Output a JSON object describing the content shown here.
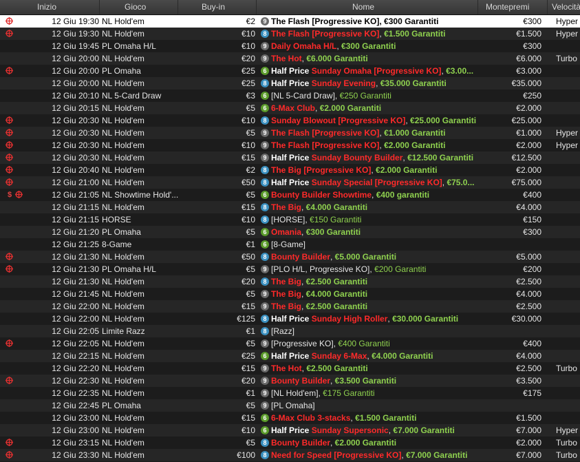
{
  "headers": {
    "start": "Inizio",
    "game": "Gioco",
    "buyin": "Buy-in",
    "name": "Nome",
    "prize": "Montepremi",
    "speed": "Velocità"
  },
  "colors": {
    "red_name": "#ff2a2a",
    "green_guarantee": "#8fd14f",
    "badge6": "#5a9a2a",
    "badge8": "#3a8fbf",
    "badge9": "#6a6a6a"
  },
  "rows": [
    {
      "icon": "target-icon",
      "date": "12 Giu",
      "time": "19:30",
      "game": "NL Hold'em",
      "buyin": "€2",
      "badge": "9",
      "hp": "",
      "red": "",
      "white": "The Flash [Progressive KO], €300 Garantiti",
      "green": "",
      "prize": "€300",
      "speed": "Hyper",
      "selected": true
    },
    {
      "icon": "target-icon",
      "date": "12 Giu",
      "time": "19:30",
      "game": "NL Hold'em",
      "buyin": "€10",
      "badge": "8",
      "hp": "",
      "red": "The Flash [Progressive KO]",
      "white": "",
      "green": "€1.500 Garantiti",
      "prize": "€1.500",
      "speed": "Hyper"
    },
    {
      "icon": "",
      "date": "12 Giu",
      "time": "19:45",
      "game": "PL Omaha H/L",
      "buyin": "€10",
      "badge": "9",
      "hp": "",
      "red": "Daily Omaha H/L",
      "white": "",
      "green": "€300 Garantiti",
      "prize": "€300",
      "speed": ""
    },
    {
      "icon": "",
      "date": "12 Giu",
      "time": "20:00",
      "game": "NL Hold'em",
      "buyin": "€20",
      "badge": "9",
      "hp": "",
      "red": "The Hot",
      "white": "",
      "green": "€6.000 Garantiti",
      "prize": "€6.000",
      "speed": "Turbo"
    },
    {
      "icon": "target-icon",
      "date": "12 Giu",
      "time": "20:00",
      "game": "PL Omaha",
      "buyin": "€25",
      "badge": "6",
      "hp": "Half Price",
      "red": "Sunday Omaha [Progressive KO]",
      "white": "",
      "green": "€3.00...",
      "prize": "€3.000",
      "speed": ""
    },
    {
      "icon": "",
      "date": "12 Giu",
      "time": "20:00",
      "game": "NL Hold'em",
      "buyin": "€25",
      "badge": "8",
      "hp": "Half Price",
      "red": "Sunday Evening",
      "white": "",
      "green": "€35.000 Garantiti",
      "prize": "€35.000",
      "speed": ""
    },
    {
      "icon": "",
      "date": "12 Giu",
      "time": "20:10",
      "game": "NL 5-Card Draw",
      "buyin": "€3",
      "badge": "6",
      "hp": "",
      "red": "",
      "white": "[NL 5-Card Draw]",
      "green": "€250 Garantiti",
      "greenPlain": true,
      "prize": "€250",
      "speed": ""
    },
    {
      "icon": "",
      "date": "12 Giu",
      "time": "20:15",
      "game": "NL Hold'em",
      "buyin": "€5",
      "badge": "6",
      "hp": "",
      "red": "6-Max Club",
      "white": "",
      "green": "€2.000 Garantiti",
      "prize": "€2.000",
      "speed": ""
    },
    {
      "icon": "target-icon",
      "date": "12 Giu",
      "time": "20:30",
      "game": "NL Hold'em",
      "buyin": "€10",
      "badge": "8",
      "hp": "",
      "red": "Sunday Blowout [Progressive KO]",
      "white": "",
      "green": "€25.000 Garantiti",
      "prize": "€25.000",
      "speed": ""
    },
    {
      "icon": "target-icon",
      "date": "12 Giu",
      "time": "20:30",
      "game": "NL Hold'em",
      "buyin": "€5",
      "badge": "9",
      "hp": "",
      "red": "The Flash [Progressive KO]",
      "white": "",
      "green": "€1.000 Garantiti",
      "prize": "€1.000",
      "speed": "Hyper"
    },
    {
      "icon": "target-icon",
      "date": "12 Giu",
      "time": "20:30",
      "game": "NL Hold'em",
      "buyin": "€10",
      "badge": "9",
      "hp": "",
      "red": "The Flash [Progressive KO]",
      "white": "",
      "green": "€2.000 Garantiti",
      "prize": "€2.000",
      "speed": "Hyper"
    },
    {
      "icon": "target-icon",
      "date": "12 Giu",
      "time": "20:30",
      "game": "NL Hold'em",
      "buyin": "€15",
      "badge": "9",
      "hp": "Half Price",
      "red": "Sunday Bounty Builder",
      "white": "",
      "green": "€12.500 Garantiti",
      "prize": "€12.500",
      "speed": ""
    },
    {
      "icon": "target-icon",
      "date": "12 Giu",
      "time": "20:40",
      "game": "NL Hold'em",
      "buyin": "€2",
      "badge": "8",
      "hp": "",
      "red": "The Big [Progressive KO]",
      "white": "",
      "green": "€2.000 Garantiti",
      "prize": "€2.000",
      "speed": ""
    },
    {
      "icon": "target-icon",
      "date": "12 Giu",
      "time": "21:00",
      "game": "NL Hold'em",
      "buyin": "€50",
      "badge": "8",
      "hp": "Half Price",
      "red": "Sunday Special [Progressive KO]",
      "white": "",
      "green": "€75.0...",
      "prize": "€75.000",
      "speed": ""
    },
    {
      "icon": "dollar-target-icon",
      "date": "12 Giu",
      "time": "21:05",
      "game": "NL Showtime Hold'...",
      "buyin": "€5",
      "badge": "6",
      "hp": "",
      "red": "Bounty Builder Showtime",
      "white": "",
      "green": "€400 garantiti",
      "prize": "€400",
      "speed": ""
    },
    {
      "icon": "",
      "date": "12 Giu",
      "time": "21:15",
      "game": "NL Hold'em",
      "buyin": "€15",
      "badge": "8",
      "hp": "",
      "red": "The Big",
      "white": "",
      "green": "€4.000 Garantiti",
      "prize": "€4.000",
      "speed": ""
    },
    {
      "icon": "",
      "date": "12 Giu",
      "time": "21:15",
      "game": "HORSE",
      "buyin": "€10",
      "badge": "8",
      "hp": "",
      "red": "",
      "white": "[HORSE]",
      "green": "€150 Garantiti",
      "greenPlain": true,
      "prize": "€150",
      "speed": ""
    },
    {
      "icon": "",
      "date": "12 Giu",
      "time": "21:20",
      "game": "PL Omaha",
      "buyin": "€5",
      "badge": "6",
      "hp": "",
      "red": "Omania",
      "white": "",
      "green": "€300 Garantiti",
      "prize": "€300",
      "speed": ""
    },
    {
      "icon": "",
      "date": "12 Giu",
      "time": "21:25",
      "game": "8-Game",
      "buyin": "€1",
      "badge": "6",
      "hp": "",
      "red": "",
      "white": "[8-Game]",
      "green": "",
      "prize": "",
      "speed": ""
    },
    {
      "icon": "target-icon",
      "date": "12 Giu",
      "time": "21:30",
      "game": "NL Hold'em",
      "buyin": "€50",
      "badge": "8",
      "hp": "",
      "red": "Bounty Builder",
      "white": "",
      "green": "€5.000 Garantiti",
      "prize": "€5.000",
      "speed": ""
    },
    {
      "icon": "target-icon",
      "date": "12 Giu",
      "time": "21:30",
      "game": "PL Omaha H/L",
      "buyin": "€5",
      "badge": "9",
      "hp": "",
      "red": "",
      "white": "[PLO H/L, Progressive KO]",
      "green": "€200 Garantiti",
      "greenPlain": true,
      "prize": "€200",
      "speed": ""
    },
    {
      "icon": "",
      "date": "12 Giu",
      "time": "21:30",
      "game": "NL Hold'em",
      "buyin": "€20",
      "badge": "8",
      "hp": "",
      "red": "The Big",
      "white": "",
      "green": "€2.500 Garantiti",
      "prize": "€2.500",
      "speed": ""
    },
    {
      "icon": "",
      "date": "12 Giu",
      "time": "21:45",
      "game": "NL Hold'em",
      "buyin": "€5",
      "badge": "9",
      "hp": "",
      "red": "The Big",
      "white": "",
      "green": "€4.000 Garantiti",
      "prize": "€4.000",
      "speed": ""
    },
    {
      "icon": "",
      "date": "12 Giu",
      "time": "22:00",
      "game": "NL Hold'em",
      "buyin": "€15",
      "badge": "9",
      "hp": "",
      "red": "The Big",
      "white": "",
      "green": "€2.500 Garantiti",
      "prize": "€2.500",
      "speed": ""
    },
    {
      "icon": "",
      "date": "12 Giu",
      "time": "22:00",
      "game": "NL Hold'em",
      "buyin": "€125",
      "badge": "8",
      "hp": "Half Price",
      "red": "Sunday High Roller",
      "white": "",
      "green": "€30.000 Garantiti",
      "prize": "€30.000",
      "speed": ""
    },
    {
      "icon": "",
      "date": "12 Giu",
      "time": "22:05",
      "game": "Limite Razz",
      "buyin": "€1",
      "badge": "8",
      "hp": "",
      "red": "",
      "white": "[Razz]",
      "green": "",
      "prize": "",
      "speed": ""
    },
    {
      "icon": "target-icon",
      "date": "12 Giu",
      "time": "22:05",
      "game": "NL Hold'em",
      "buyin": "€5",
      "badge": "9",
      "hp": "",
      "red": "",
      "white": "[Progressive KO]",
      "green": "€400 Garantiti",
      "greenPlain": true,
      "prize": "€400",
      "speed": ""
    },
    {
      "icon": "",
      "date": "12 Giu",
      "time": "22:15",
      "game": "NL Hold'em",
      "buyin": "€25",
      "badge": "6",
      "hp": "Half Price",
      "red": "Sunday 6-Max",
      "white": "",
      "green": "€4.000 Garantiti",
      "prize": "€4.000",
      "speed": ""
    },
    {
      "icon": "",
      "date": "12 Giu",
      "time": "22:20",
      "game": "NL Hold'em",
      "buyin": "€15",
      "badge": "9",
      "hp": "",
      "red": "The Hot",
      "white": "",
      "green": "€2.500 Garantiti",
      "prize": "€2.500",
      "speed": "Turbo"
    },
    {
      "icon": "target-icon",
      "date": "12 Giu",
      "time": "22:30",
      "game": "NL Hold'em",
      "buyin": "€20",
      "badge": "9",
      "hp": "",
      "red": "Bounty Builder",
      "white": "",
      "green": "€3.500 Garantiti",
      "prize": "€3.500",
      "speed": ""
    },
    {
      "icon": "",
      "date": "12 Giu",
      "time": "22:35",
      "game": "NL Hold'em",
      "buyin": "€1",
      "badge": "9",
      "hp": "",
      "red": "",
      "white": "[NL Hold'em]",
      "green": "€175 Garantiti",
      "greenPlain": true,
      "prize": "€175",
      "speed": ""
    },
    {
      "icon": "",
      "date": "12 Giu",
      "time": "22:45",
      "game": "PL Omaha",
      "buyin": "€5",
      "badge": "9",
      "hp": "",
      "red": "",
      "white": "[PL Omaha]",
      "green": "",
      "prize": "",
      "speed": ""
    },
    {
      "icon": "",
      "date": "12 Giu",
      "time": "23:00",
      "game": "NL Hold'em",
      "buyin": "€15",
      "badge": "6",
      "hp": "",
      "red": "6-Max Club 3-stacks",
      "white": "",
      "green": "€1.500 Garantiti",
      "prize": "€1.500",
      "speed": ""
    },
    {
      "icon": "",
      "date": "12 Giu",
      "time": "23:00",
      "game": "NL Hold'em",
      "buyin": "€10",
      "badge": "6",
      "hp": "Half Price",
      "red": "Sunday Supersonic",
      "white": "",
      "green": "€7.000 Garantiti",
      "prize": "€7.000",
      "speed": "Hyper"
    },
    {
      "icon": "target-icon",
      "date": "12 Giu",
      "time": "23:15",
      "game": "NL Hold'em",
      "buyin": "€5",
      "badge": "8",
      "hp": "",
      "red": "Bounty Builder",
      "white": "",
      "green": "€2.000 Garantiti",
      "prize": "€2.000",
      "speed": "Turbo"
    },
    {
      "icon": "target-icon",
      "date": "12 Giu",
      "time": "23:30",
      "game": "NL Hold'em",
      "buyin": "€100",
      "badge": "8",
      "hp": "",
      "red": "Need for Speed [Progressive KO]",
      "white": "",
      "green": "€7.000 Garantiti",
      "prize": "€7.000",
      "speed": "Turbo"
    }
  ]
}
